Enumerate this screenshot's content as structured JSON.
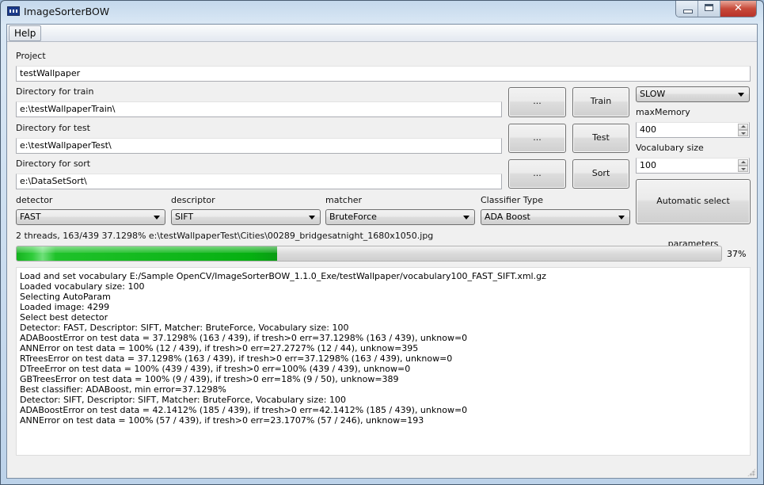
{
  "window": {
    "title": "ImageSorterBOW",
    "app_icon": "app-window-icon",
    "caption_buttons": [
      "minimize",
      "maximize",
      "close"
    ]
  },
  "menu": {
    "items": [
      {
        "label": "Help"
      }
    ]
  },
  "project": {
    "label": "Project",
    "value": "testWallpaper"
  },
  "train": {
    "label": "Directory for train",
    "value": "e:\\testWallpaperTrain\\",
    "browse_label": "...",
    "action_label": "Train"
  },
  "test": {
    "label": "Directory for test",
    "value": "e:\\testWallpaperTest\\",
    "browse_label": "...",
    "action_label": "Test"
  },
  "sort": {
    "label": "Directory for sort",
    "value": "e:\\DataSetSort\\",
    "browse_label": "...",
    "action_label": "Sort"
  },
  "right_panel": {
    "speed_mode": "SLOW",
    "max_memory": {
      "label": "maxMemory",
      "value": "400"
    },
    "vocabulary_size": {
      "label": "Vocalubary size",
      "value": "100"
    },
    "auto_select_label": "Automatic select parameters"
  },
  "selectors": {
    "detector": {
      "label": "detector",
      "value": "FAST"
    },
    "descriptor": {
      "label": "descriptor",
      "value": "SIFT"
    },
    "matcher": {
      "label": "matcher",
      "value": "BruteForce"
    },
    "classifier": {
      "label": "Classifier Type",
      "value": "ADA Boost"
    }
  },
  "status": {
    "text": "2 threads, 163/439 37.1298% e:\\testWallpaperTest\\Cities\\00289_bridgesatnight_1680x1050.jpg",
    "progress_percent": 37,
    "progress_label": "37%",
    "progress_color": "#06b011"
  },
  "log": [
    "Load and set vocabulary E:/Sample OpenCV/ImageSorterBOW_1.1.0_Exe/testWallpaper/vocabulary100_FAST_SIFT.xml.gz",
    "Loaded vocabulary size: 100",
    "Selecting AutoParam",
    "Loaded image: 4299",
    "Select best detector",
    "Detector: FAST, Descriptor: SIFT, Matcher: BruteForce, Vocabulary size: 100",
    "ADABoostError on test data = 37.1298% (163 / 439), if tresh>0 err=37.1298% (163 / 439), unknow=0",
    "ANNError on test data = 100% (12 / 439), if tresh>0 err=27.2727% (12 / 44), unknow=395",
    "RTreesError on test data = 37.1298% (163 / 439), if tresh>0 err=37.1298% (163 / 439), unknow=0",
    "DTreeError on test data = 100% (439 / 439), if tresh>0 err=100% (439 / 439), unknow=0",
    "GBTreesError on test data = 100% (9 / 439), if tresh>0 err=18% (9 / 50), unknow=389",
    "Best classifier: ADABoost, min error=37.1298%",
    "Detector: SIFT, Descriptor: SIFT, Matcher: BruteForce, Vocabulary size: 100",
    "ADABoostError on test data = 42.1412% (185 / 439), if tresh>0 err=42.1412% (185 / 439), unknow=0",
    "ANNError on test data = 100% (57 / 439), if tresh>0 err=23.1707% (57 / 246), unknow=193"
  ]
}
